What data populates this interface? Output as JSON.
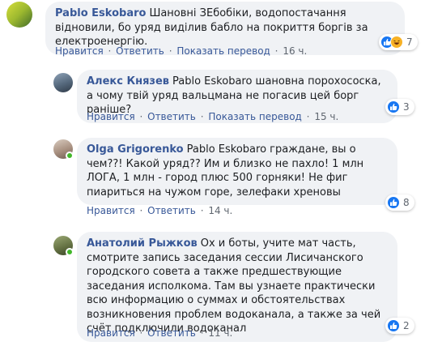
{
  "comments": [
    {
      "author": "Pablo Eskobaro",
      "text": "Шановні ЗЕбобіки, водопостачання відновили, бо уряд виділив бабло на покриття боргів за електроенергію.",
      "actions": {
        "like": "Нравится",
        "reply": "Ответить",
        "translate": "Показать перевод",
        "time": "16 ч."
      },
      "reactions": {
        "count": "7",
        "types": [
          "like",
          "haha"
        ]
      },
      "avatar_colors": [
        "#c9d63a",
        "#4a7a2a"
      ]
    },
    {
      "author": "Алекс Князев",
      "text": "Pablo Eskobaro шановна порохососка, а чому твій уряд вальцмана не погасив цей борг раніше?",
      "actions": {
        "like": "Нравится",
        "reply": "Ответить",
        "translate": "Показать перевод",
        "time": "15 ч."
      },
      "reactions": {
        "count": "3",
        "types": [
          "like"
        ]
      },
      "avatar_colors": [
        "#6b7f95",
        "#3b4a5c"
      ]
    },
    {
      "author": "Olga Grigorenko",
      "text": "Pablo Eskobaro граждане, вы о чем??! Какой уряд?? Им и близко не пахло! 1 млн ЛОГА, 1 млн - город плюс 500 горняки! Не фиг пиариться на чужом горе, зелефаки хреновы",
      "actions": {
        "like": "Нравится",
        "reply": "Ответить",
        "time": "14 ч."
      },
      "reactions": {
        "count": "8",
        "types": [
          "like"
        ]
      },
      "avatar_colors": [
        "#c8b8a8",
        "#7a6a60"
      ]
    },
    {
      "author": "Анатолий Рыжков",
      "text": "Ох и боты, учите мат часть, смотрите запись заседания сессии Лисичанского городского совета а также предшествующие заседания исполкома. Там вы узнаете практически всю информацию о суммах и обстоятельствах возникновения проблем водоканала, а также за чей счёт подключили водоканал",
      "actions": {
        "like": "Нравится",
        "reply": "Ответить",
        "time": "11 ч."
      },
      "reactions": {
        "count": "2",
        "types": [
          "like"
        ]
      },
      "avatar_colors": [
        "#7d8a5a",
        "#3e4a2a"
      ]
    }
  ]
}
